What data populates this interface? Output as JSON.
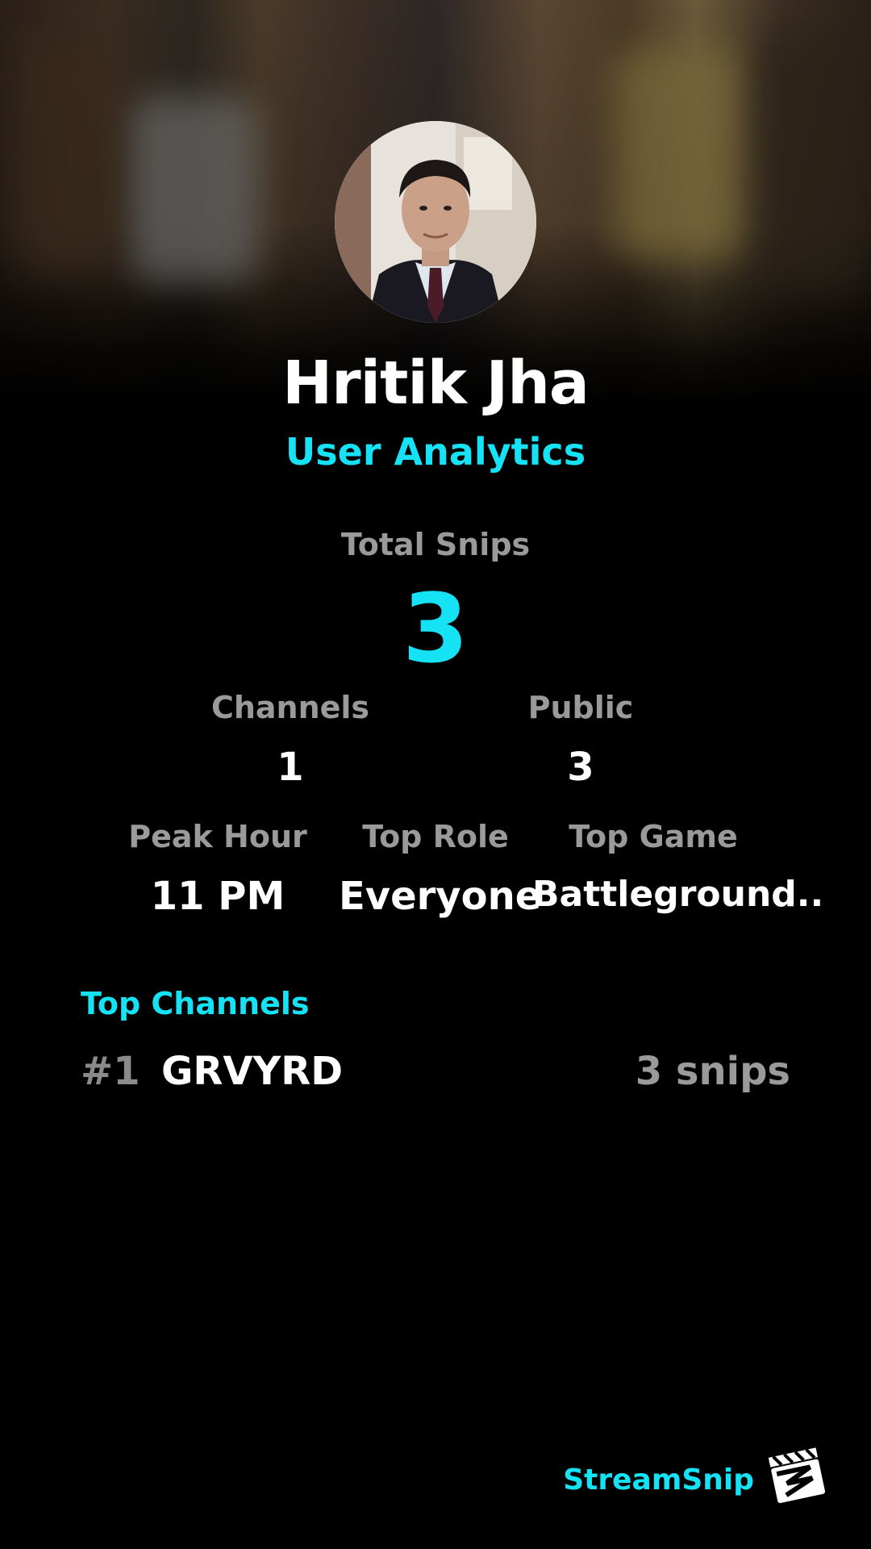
{
  "profile": {
    "name": "Hritik Jha",
    "subtitle": "User Analytics"
  },
  "total": {
    "label": "Total Snips",
    "value": "3"
  },
  "stats_row1": [
    {
      "label": "Channels",
      "value": "1"
    },
    {
      "label": "Public",
      "value": "3"
    }
  ],
  "stats_row2": [
    {
      "label": "Peak Hour",
      "value": "11 PM"
    },
    {
      "label": "Top Role",
      "value": "Everyone"
    },
    {
      "label": "Top Game",
      "value": "Battleground.."
    }
  ],
  "top_channels": {
    "title": "Top Channels",
    "items": [
      {
        "rank": "#1",
        "name": "GRVYRD",
        "snips": "3 snips"
      }
    ]
  },
  "brand": {
    "name": "StreamSnip",
    "logo_icon": "clapperboard-icon"
  },
  "colors": {
    "accent": "#15e3f5",
    "background": "#000000",
    "muted": "#9a9a9a"
  }
}
